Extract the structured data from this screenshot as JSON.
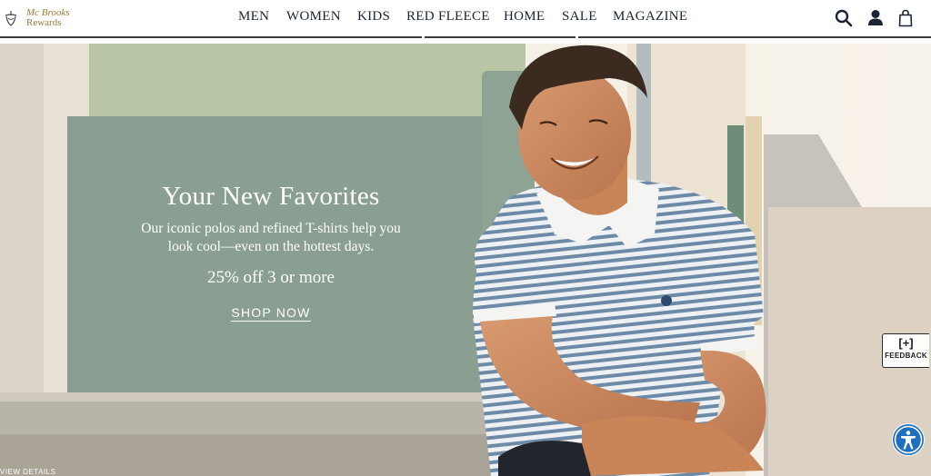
{
  "header": {
    "logo": {
      "line1": "Mc Brooks",
      "line2": "Rewards",
      "icon": "golden-fleece-icon"
    },
    "nav": [
      {
        "label": "MEN"
      },
      {
        "label": "WOMEN"
      },
      {
        "label": "KIDS"
      },
      {
        "label": "RED FLEECE"
      },
      {
        "label": "HOME"
      },
      {
        "label": "SALE"
      },
      {
        "label": "MAGAZINE"
      }
    ],
    "icons": [
      "search-icon",
      "account-icon",
      "shopping-bag-icon"
    ]
  },
  "hero": {
    "title": "Your New Favorites",
    "description_line1": "Our iconic polos and refined T-shirts help you",
    "description_line2": "look cool—even on the hottest days.",
    "offer": "25% off 3 or more",
    "cta": "SHOP NOW",
    "view_details": "VIEW DETAILS"
  },
  "feedback": {
    "symbol": "[+]",
    "label": "FEEDBACK"
  },
  "accessibility": {
    "icon": "accessibility-icon"
  },
  "colors": {
    "nav_text": "#1b2434",
    "logo_gold": "#a0793a",
    "bench_green": "#8fa596",
    "accessibility_blue": "#1f6fc1"
  }
}
